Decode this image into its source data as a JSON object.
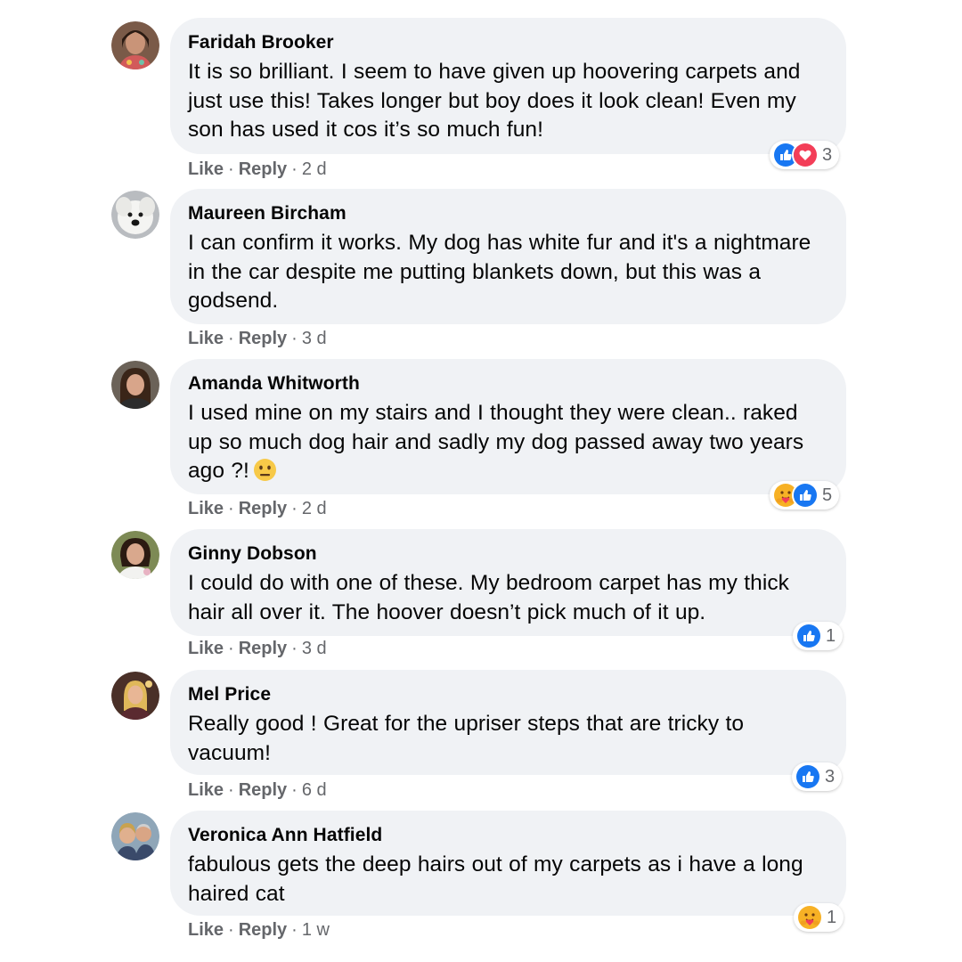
{
  "comments": [
    {
      "author": "Faridah Brooker",
      "text": "It is so brilliant. I seem to have given up hoovering carpets and just use this! Takes longer but boy does it look clean! Even my son has used it cos it’s so much fun!",
      "actions": {
        "like": "Like",
        "reply": "Reply",
        "time": "2 d"
      },
      "reactions": {
        "icons": [
          "like-icon",
          "love-icon"
        ],
        "count": "3"
      }
    },
    {
      "author": "Maureen Bircham",
      "text": "I can confirm it works. My dog has white fur and it's a nightmare in the car despite me putting blankets down, but this was a godsend.",
      "actions": {
        "like": "Like",
        "reply": "Reply",
        "time": "3 d"
      }
    },
    {
      "author": "Amanda Whitworth",
      "text": "I used mine on my stairs and I thought they were clean.. raked up so much dog hair and sadly my dog passed away two years ago ?!",
      "text_emoji": "neutral-face-emoji",
      "actions": {
        "like": "Like",
        "reply": "Reply",
        "time": "2 d"
      },
      "reactions": {
        "icons": [
          "care-icon",
          "like-icon"
        ],
        "count": "5"
      }
    },
    {
      "author": "Ginny Dobson",
      "text": "I could do with one of these. My bedroom carpet has my thick hair all over it. The hoover doesn’t pick much of it up.",
      "actions": {
        "like": "Like",
        "reply": "Reply",
        "time": "3 d"
      },
      "reactions": {
        "icons": [
          "like-icon"
        ],
        "count": "1"
      }
    },
    {
      "author": "Mel Price",
      "text": "Really good ! Great for the upriser steps that are tricky to vacuum!",
      "actions": {
        "like": "Like",
        "reply": "Reply",
        "time": "6 d"
      },
      "reactions": {
        "icons": [
          "like-icon"
        ],
        "count": "3"
      }
    },
    {
      "author": "Veronica Ann Hatfield",
      "text": "fabulous gets the deep hairs out of my carpets as i have a long haired cat",
      "actions": {
        "like": "Like",
        "reply": "Reply",
        "time": "1 w"
      },
      "reactions": {
        "icons": [
          "care-icon"
        ],
        "count": "1"
      }
    }
  ],
  "colors": {
    "bubble": "#f0f2f5",
    "text": "#050505",
    "meta": "#65676b",
    "like_blue": "#1877f2",
    "love_red": "#f33e58",
    "care_yellow": "#f7b125"
  }
}
